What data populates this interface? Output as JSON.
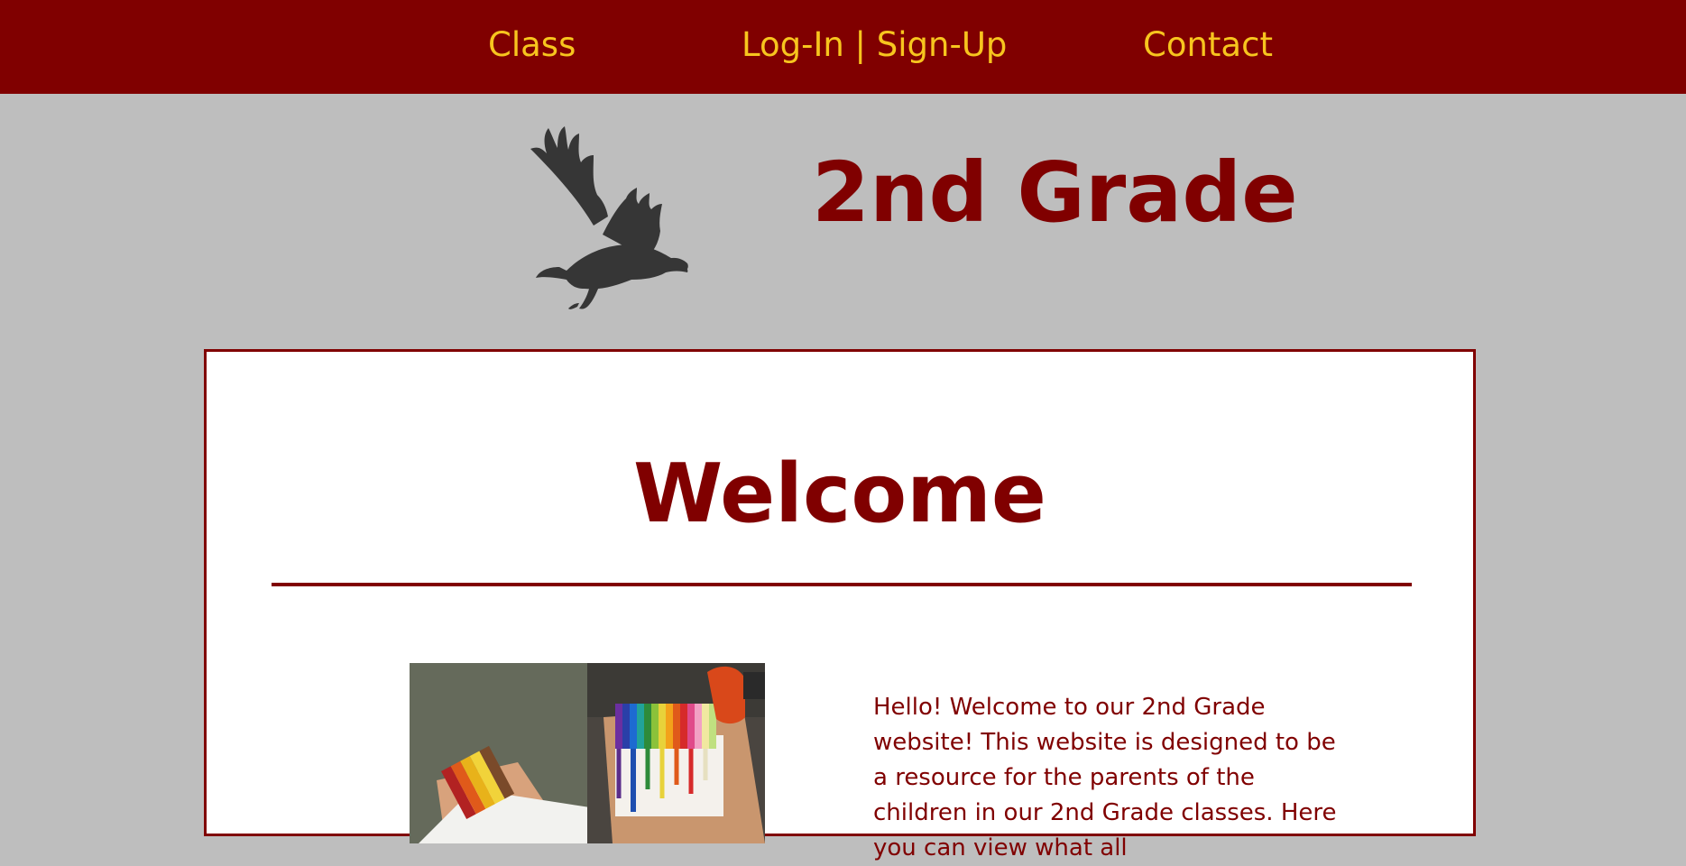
{
  "nav": {
    "items": [
      {
        "label": "Class"
      },
      {
        "label": "Log-In | Sign-Up"
      },
      {
        "label": "Contact"
      }
    ]
  },
  "header": {
    "logo_icon": "eagle-silhouette-icon",
    "title": "2nd Grade"
  },
  "main": {
    "heading": "Welcome",
    "image_description_icon": "crayon-art-photo",
    "intro_text": "Hello! Welcome to our 2nd Grade website! This website is designed to be a resource for the parents of the children in our 2nd Grade classes. Here you can view what all"
  },
  "colors": {
    "nav_bg": "#800000",
    "nav_text": "#f7c51e",
    "page_bg": "#bebebe",
    "accent": "#800000",
    "panel_bg": "#ffffff"
  }
}
